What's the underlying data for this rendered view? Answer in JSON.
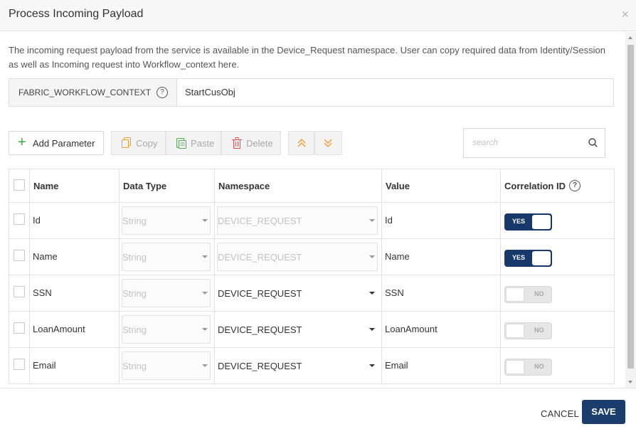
{
  "dialog": {
    "title": "Process Incoming Payload",
    "close_glyph": "×"
  },
  "description": "The incoming request payload from the service is available in the Device_Request namespace. User can copy required data from Identity/Session as well as Incoming request into Workflow_context here.",
  "context": {
    "label": "FABRIC_WORKFLOW_CONTEXT",
    "help": "?",
    "value": "StartCusObj"
  },
  "toolbar": {
    "add_label": "Add Parameter",
    "copy_label": "Copy",
    "paste_label": "Paste",
    "delete_label": "Delete",
    "move_up_icon": "double-chevron-up-icon",
    "move_down_icon": "double-chevron-down-icon"
  },
  "search": {
    "placeholder": "search",
    "icon": "search-icon"
  },
  "table": {
    "headers": {
      "name": "Name",
      "data_type": "Data Type",
      "namespace": "Namespace",
      "value": "Value",
      "correlation_id": "Correlation ID",
      "correlation_help": "?"
    },
    "rows": [
      {
        "name": "Id",
        "data_type": "String",
        "namespace": "DEVICE_REQUEST",
        "value": "Id",
        "correlation": "YES"
      },
      {
        "name": "Name",
        "data_type": "String",
        "namespace": "DEVICE_REQUEST",
        "value": "Name",
        "correlation": "YES"
      },
      {
        "name": "SSN",
        "data_type": "String",
        "namespace": "DEVICE_REQUEST",
        "value": "SSN",
        "correlation": "NO"
      },
      {
        "name": "LoanAmount",
        "data_type": "String",
        "namespace": "DEVICE_REQUEST",
        "value": "LoanAmount",
        "correlation": "NO"
      },
      {
        "name": "Email",
        "data_type": "String",
        "namespace": "DEVICE_REQUEST",
        "value": "Email",
        "correlation": "NO"
      }
    ]
  },
  "footer": {
    "cancel_label": "CANCEL",
    "save_label": "SAVE"
  },
  "colors": {
    "primary": "#1a3d6e",
    "toggle_on": "#17386b",
    "add_icon": "#43a047",
    "copy_icon": "#f0a030",
    "paste_icon": "#4caf50",
    "delete_icon": "#e05050",
    "arrow_icon": "#f0a030"
  }
}
